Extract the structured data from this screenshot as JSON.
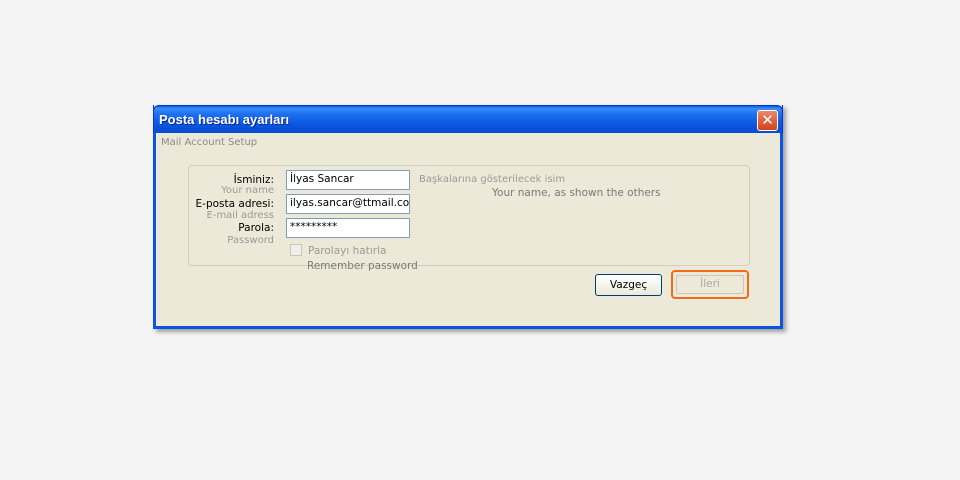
{
  "window": {
    "title": "Posta hesabı ayarları",
    "subtitle": "Mail Account Setup",
    "close_glyph": "✕"
  },
  "form": {
    "name_label": "İsminiz:",
    "name_label_en": "Your name",
    "name_value": "İlyas Sancar",
    "email_label": "E-posta adresi:",
    "email_label_en": "E-mail adress",
    "email_value": "ilyas.sancar@ttmail.com",
    "password_label": "Parola:",
    "password_label_en": "Password",
    "password_value": "*********",
    "name_hint": "Başkalarına gösterilecek isim",
    "name_hint_en": "Your name, as shown the others",
    "remember_label": "Parolayı hatırla",
    "remember_label_en": "Remember password",
    "remember_checked": false
  },
  "buttons": {
    "cancel": "Vazgeç",
    "next": "İleri"
  },
  "colors": {
    "titlebar": "#0b55e0",
    "dialog_bg": "#ece9d8",
    "highlight": "#f26b1d"
  },
  "icons": {
    "close": "close-icon"
  }
}
